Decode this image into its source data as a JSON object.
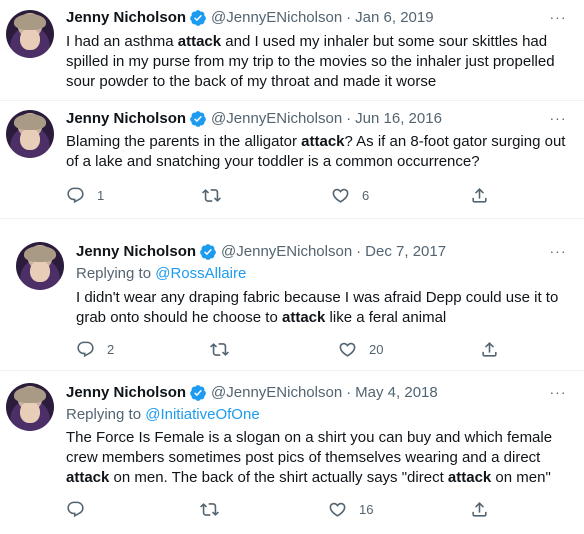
{
  "tweets": [
    {
      "name": "Jenny Nicholson",
      "handle": "@JennyENicholson",
      "sep": "·",
      "date": "Jan 6, 2019",
      "more": "···",
      "text_parts": [
        "I had an asthma ",
        "attack",
        " and I used my inhaler but some sour skittles had spilled in my purse from my trip to the movies so the inhaler just propelled sour powder to the back of my throat and made it worse"
      ]
    },
    {
      "name": "Jenny Nicholson",
      "handle": "@JennyENicholson",
      "sep": "·",
      "date": "Jun 16, 2016",
      "more": "···",
      "text_parts": [
        "Blaming the parents in the alligator ",
        "attack",
        "? As if an 8-foot gator surging out of a lake and snatching your toddler is a common occurrence?"
      ],
      "replies": "1",
      "retweets": "",
      "likes": "6"
    },
    {
      "name": "Jenny Nicholson",
      "handle": "@JennyENicholson",
      "sep": "·",
      "date": "Dec 7, 2017",
      "more": "···",
      "replying_prefix": "Replying to ",
      "replying_to": "@RossAllaire",
      "text_parts": [
        "I didn't wear any draping fabric because I was afraid Depp could use it to grab onto should he choose to ",
        "attack",
        " like a feral animal"
      ],
      "replies": "2",
      "retweets": "",
      "likes": "20"
    },
    {
      "name": "Jenny Nicholson",
      "handle": "@JennyENicholson",
      "sep": "·",
      "date": "May 4, 2018",
      "more": "···",
      "replying_prefix": "Replying to ",
      "replying_to": "@InitiativeOfOne",
      "text_parts": [
        "The Force Is Female is a slogan on a shirt you can buy and which female crew members sometimes post pics of themselves wearing and a direct ",
        "attack",
        " on men. The back of the shirt actually says \"direct ",
        "attack",
        " on men\""
      ],
      "replies": "",
      "retweets": "",
      "likes": "16"
    }
  ],
  "colors": {
    "accent": "#1d9bf0",
    "secondary": "#536471",
    "text": "#0f1419",
    "divider": "#eff3f4"
  },
  "icons": {
    "verified": "verified-badge-icon",
    "reply": "reply-icon",
    "retweet": "retweet-icon",
    "like": "heart-icon",
    "share": "share-icon",
    "more": "more-icon"
  }
}
